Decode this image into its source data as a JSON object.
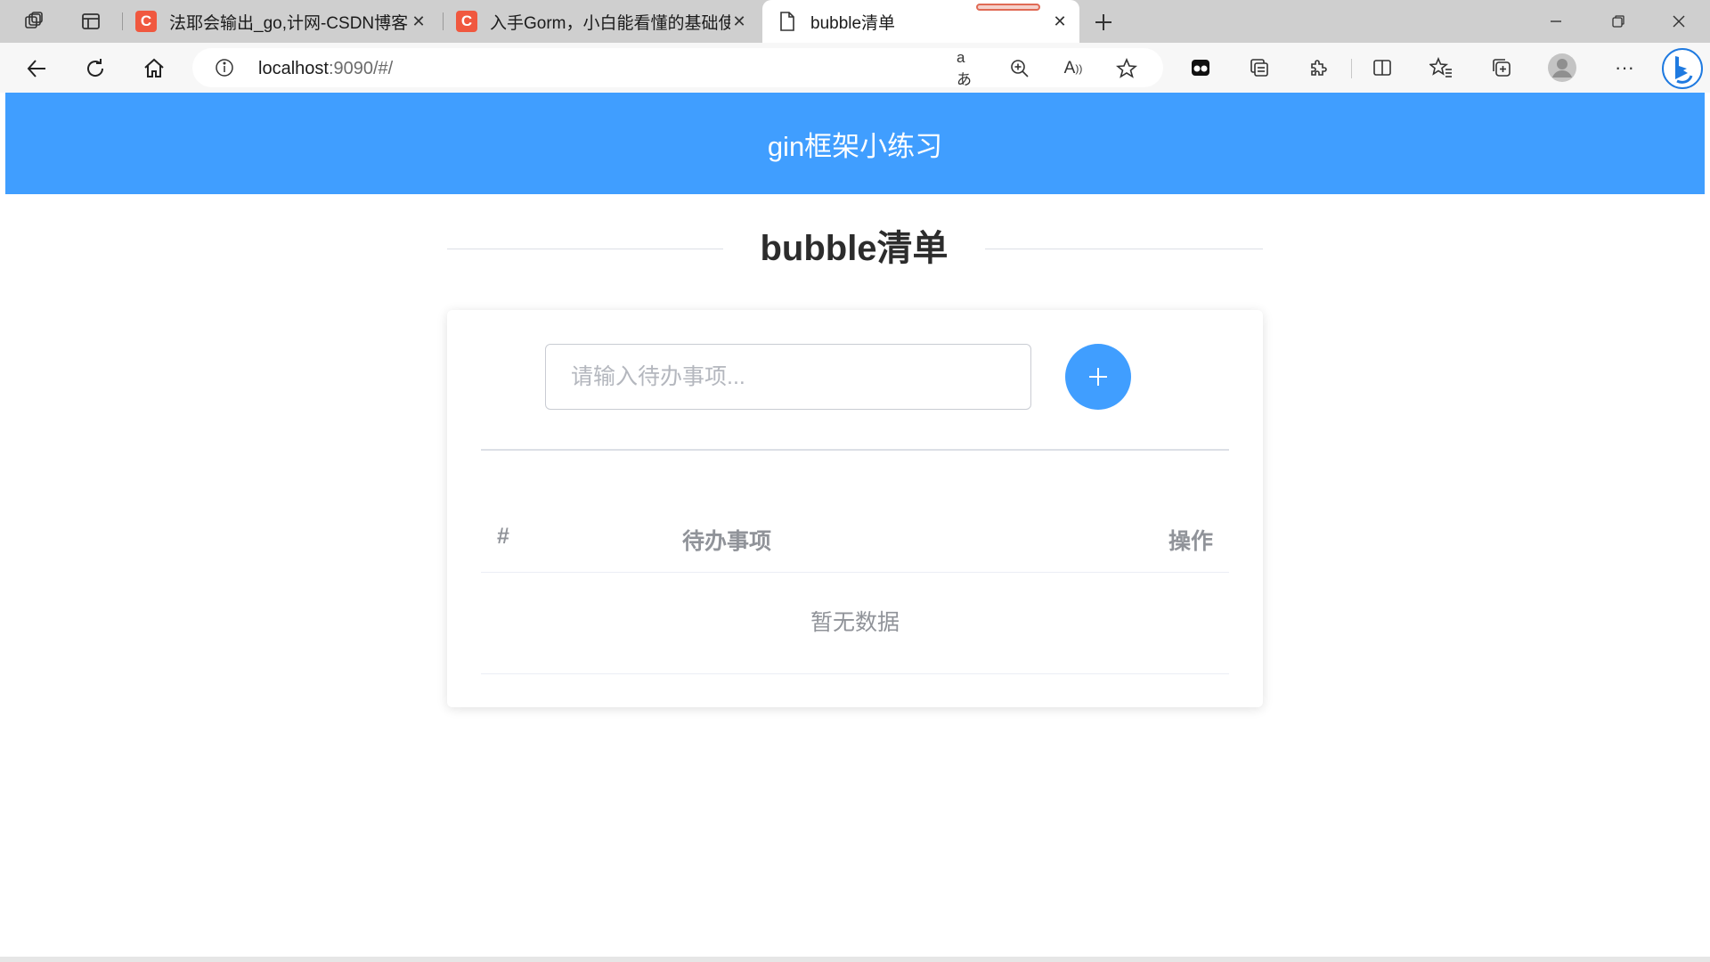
{
  "browser": {
    "tabs": [
      {
        "title": "法耶会输出_go,计网-CSDN博客",
        "favicon": "C",
        "active": false
      },
      {
        "title": "入手Gorm，小白能看懂的基础使",
        "favicon": "C",
        "active": false
      },
      {
        "title": "bubble清单",
        "favicon": "document-icon",
        "active": true
      }
    ],
    "address": {
      "host": "localhost",
      "rest": ":9090/#/"
    }
  },
  "page": {
    "header_title": "gin框架小练习",
    "card_title": "bubble清单",
    "input_placeholder": "请输入待办事项...",
    "add_button_glyph": "+",
    "table": {
      "columns": [
        "#",
        "待办事项",
        "操作"
      ],
      "empty_text": "暂无数据"
    }
  },
  "colors": {
    "primary": "#409eff",
    "favicon": "#f0583f"
  }
}
